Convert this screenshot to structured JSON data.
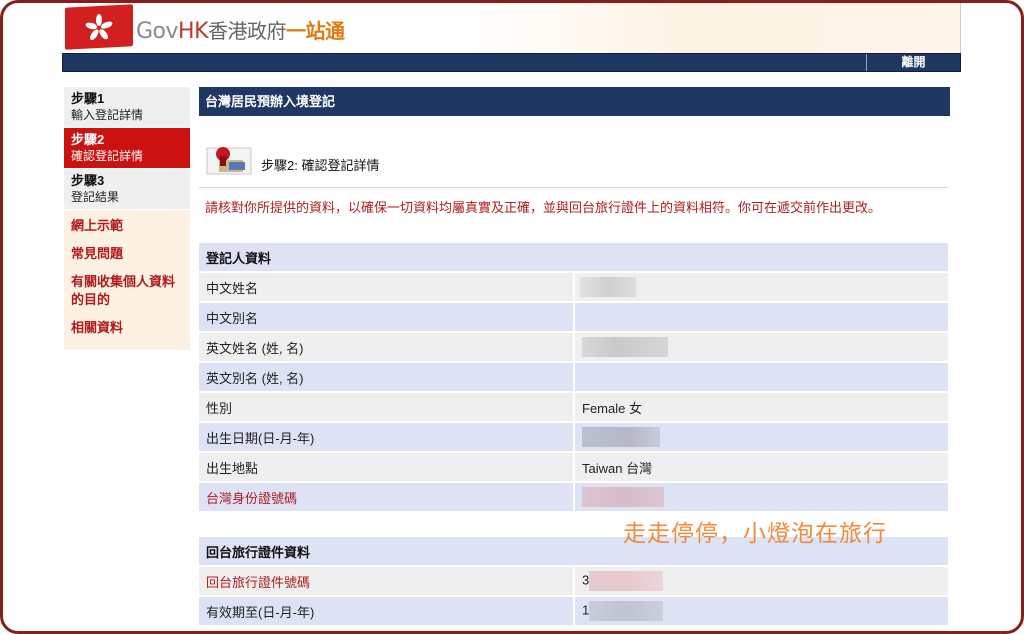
{
  "header": {
    "brand_gov": "Gov",
    "brand_hk": "HK",
    "brand_cn": "香港政府",
    "brand_one": "一站通",
    "logout_label": "離開"
  },
  "sidebar": {
    "steps": [
      {
        "label": "步驟1",
        "sub": "輸入登記詳情"
      },
      {
        "label": "步驟2",
        "sub": "確認登記詳情"
      },
      {
        "label": "步驟3",
        "sub": "登記結果"
      }
    ],
    "links": [
      "網上示範",
      "常見問題",
      "有關收集個人資料的目的",
      "相關資料"
    ]
  },
  "main": {
    "title": "台灣居民預辦入境登記",
    "step_heading": "步驟2: 確認登記詳情",
    "note": "請核對你所提供的資料，以確保一切資料均屬真實及正確，並與回台旅行證件上的資料相符。你可在遞交前作出更改。"
  },
  "section1": {
    "title": "登記人資料",
    "rows": [
      {
        "label": "中文姓名",
        "value": ""
      },
      {
        "label": "中文別名",
        "value": ""
      },
      {
        "label": "英文姓名 (姓, 名)",
        "value": ""
      },
      {
        "label": "英文別名 (姓, 名)",
        "value": ""
      },
      {
        "label": "性別",
        "value": "Female 女"
      },
      {
        "label": "出生日期(日-月-年)",
        "value": ""
      },
      {
        "label": "出生地點",
        "value": "Taiwan 台灣"
      },
      {
        "label": "台灣身份證號碼",
        "value": ""
      }
    ]
  },
  "section2": {
    "title": "回台旅行證件資料",
    "rows": [
      {
        "label": "回台旅行證件號碼",
        "value": "3"
      },
      {
        "label": "有效期至(日-月-年)",
        "value": "1"
      }
    ]
  },
  "watermark": "走走停停，小燈泡在旅行",
  "colors": {
    "navy": "#1f3763",
    "accent_red": "#cc1111",
    "link_red": "#b01c1c",
    "row_blue": "#dde3f5",
    "row_gray": "#efefef",
    "frame": "#8a1c1c"
  }
}
